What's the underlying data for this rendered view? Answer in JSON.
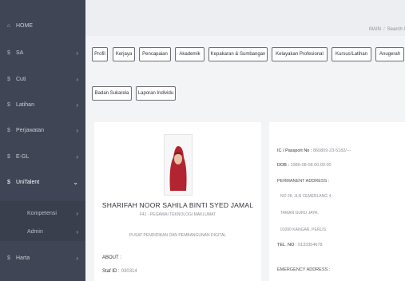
{
  "sidebar": {
    "items": [
      {
        "icon": "⌂",
        "label": "HOME",
        "chevron": ""
      },
      {
        "icon": "$",
        "label": "SA",
        "chevron": "›"
      },
      {
        "icon": "$",
        "label": "Cuti",
        "chevron": "›"
      },
      {
        "icon": "$",
        "label": "Latihan",
        "chevron": "›"
      },
      {
        "icon": "$",
        "label": "Perjawatan",
        "chevron": "›"
      },
      {
        "icon": "$",
        "label": "E-GL",
        "chevron": "›"
      },
      {
        "icon": "$",
        "label": "UniTalent",
        "chevron": "⌄"
      },
      {
        "icon": "",
        "label": "Kompetensi",
        "chevron": "›"
      },
      {
        "icon": "",
        "label": "Admin",
        "chevron": "›"
      },
      {
        "icon": "$",
        "label": "Harta",
        "chevron": "›"
      }
    ]
  },
  "breadcrumb": {
    "main": "MAIN",
    "current": "Search I"
  },
  "tabs": [
    "Profil",
    "Kerjaya",
    "Pencapaian",
    "Akademik",
    "Kepakaran & Sumbangan",
    "Kelayakan Profesional",
    "Kursus/Latihan",
    "Anugerah",
    "Badan Sukarela",
    "Laporan Individu"
  ],
  "profile": {
    "name": "SHARIFAH NOOR SAHILA BINTI SYED JAMAL",
    "position": "F41 - PEGAWAI TEKNOLOGI MAKLUMAT",
    "department": "PUSAT PENDIDIKAN DAN PEMBANGUNAN DIGITAL",
    "about_label": "ABOUT :",
    "staff_label": "Staf ID :",
    "staff_id": "030314"
  },
  "details": {
    "ic_label": "IC / Passport No :",
    "ic_value": "860809-23-5182/---",
    "dob_label": "DOB :",
    "dob_value": "1986-08-08 00:00:00",
    "address_label": "PERMANENT ADDRESS :",
    "address_lines": [
      "NO 28, JLN CEMERLANG 4,",
      "TAMAN GURU JAYA,",
      "01000 KANGAR, PERLIS"
    ],
    "tel_label": "TEL. NO :",
    "tel_value": "0133354678",
    "emergency_label": "EMERGENCY ADDRESS :"
  },
  "colors": {
    "sidebar": "#3f4554",
    "accent_hijab": "#b2242f"
  }
}
